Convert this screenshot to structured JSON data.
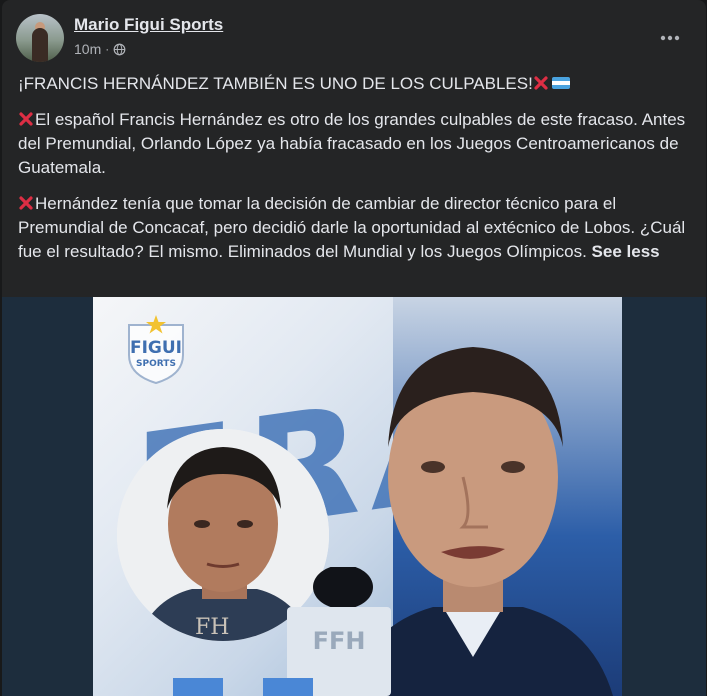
{
  "post": {
    "page_name": "Mario Figui Sports",
    "time": "10m",
    "separator": "·",
    "more_label": "•••",
    "headline": "¡FRANCIS HERNÁNDEZ TAMBIÉN ES UNO DE LOS CULPABLES!",
    "paragraph_1": "El español Francis Hernández es otro de los grandes culpables de este fracaso. Antes del Premundial, Orlando López ya había fracasado en los Juegos Centroamericanos de Guatemala.",
    "paragraph_2": "Hernández tenía que tomar la decisión de cambiar de director técnico para el Premundial de Concacaf, pero decidió darle la oportunidad al extécnico de Lobos. ¿Cuál fue el resultado? El mismo. Eliminados del Mundial y los Juegos Olímpicos.",
    "see_less": "See less"
  },
  "image": {
    "logo_line1": "FIGUI",
    "logo_line2": "SPORTS",
    "background_letters": "FRANCI",
    "mic_label": "FFH",
    "inset_watermark": "FH"
  },
  "colors": {
    "card_bg": "#242526",
    "text_primary": "#e4e6eb",
    "text_secondary": "#b0b3b8",
    "x_mark": "#dd2e44"
  },
  "icons": {
    "privacy": "globe-icon",
    "options": "more-horizontal-icon",
    "emphasis": "red-x-icon",
    "flag": "honduras-flag-icon"
  }
}
